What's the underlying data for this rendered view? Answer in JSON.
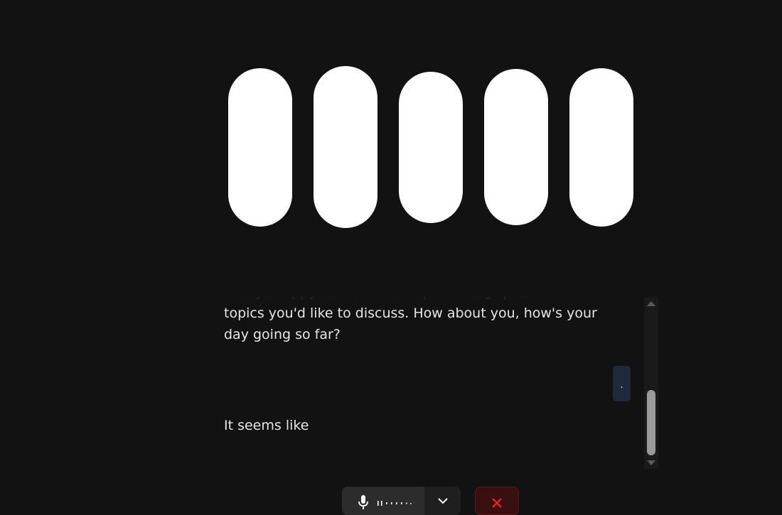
{
  "visualizer": {
    "bar_count": 5,
    "color": "#ffffff"
  },
  "transcript": {
    "assistant_message_1": "always happy to chat and help with any questions or topics you'd like to discuss. How about you, how's your day going so far?",
    "user_message": ".",
    "assistant_message_2": "It seems like"
  },
  "controls": {
    "mic_icon": "microphone-icon",
    "options_icon": "chevron-down-icon",
    "end_icon": "close-icon",
    "end_color": "#e0222b"
  }
}
